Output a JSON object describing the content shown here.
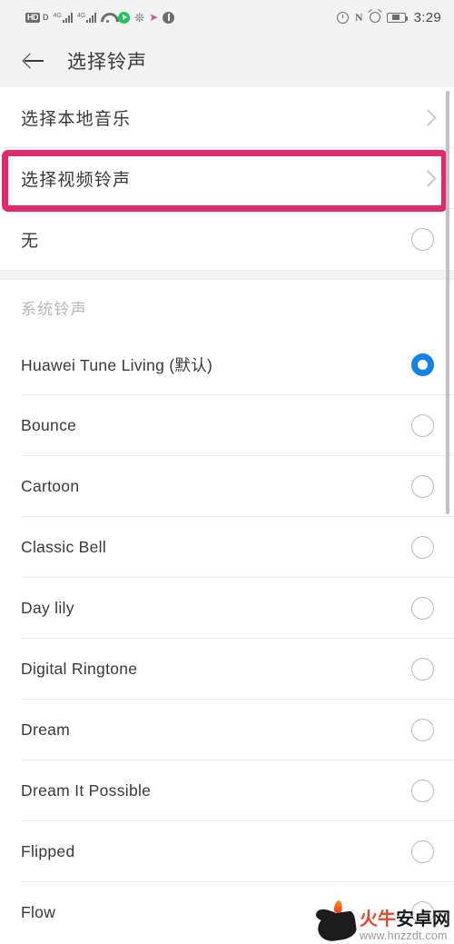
{
  "status_bar": {
    "icons_left": [
      "hd-icon",
      "volte-icon",
      "signal-4g-1-icon",
      "signal-4g-2-icon",
      "wifi-icon",
      "green-play-icon",
      "huawei-petal-icon",
      "purple-arrow-icon",
      "music-icon"
    ],
    "hd_label": "HD",
    "volte_label": "D",
    "network_label_1": "4G",
    "network_label_2": "4G",
    "nfc_label": "N",
    "icons_right": [
      "dnd-icon",
      "nfc-icon",
      "alarm-icon",
      "battery-icon"
    ],
    "time": "3:29"
  },
  "header": {
    "back_label": "back-arrow",
    "title": "选择铃声"
  },
  "top_actions": [
    {
      "label": "选择本地音乐",
      "accessory": "chevron-right-icon"
    },
    {
      "label": "选择视频铃声",
      "accessory": "chevron-right-icon",
      "highlighted": true
    }
  ],
  "none_row": {
    "label": "无",
    "selected": false
  },
  "section": {
    "title": "系统铃声"
  },
  "ringtones": [
    {
      "label": "Huawei Tune Living (默认)",
      "selected": true
    },
    {
      "label": "Bounce",
      "selected": false
    },
    {
      "label": "Cartoon",
      "selected": false
    },
    {
      "label": "Classic Bell",
      "selected": false
    },
    {
      "label": "Day lily",
      "selected": false
    },
    {
      "label": "Digital Ringtone",
      "selected": false
    },
    {
      "label": "Dream",
      "selected": false
    },
    {
      "label": "Dream It Possible",
      "selected": false
    },
    {
      "label": "Flipped",
      "selected": false
    },
    {
      "label": "Flow",
      "selected": false
    }
  ],
  "highlight": {
    "color": "#e02a6e",
    "target": "选择视频铃声"
  },
  "watermark": {
    "brand_red": "火牛",
    "brand_black": "安卓网",
    "url": "www.hnzzdt.com"
  },
  "colors": {
    "accent_blue": "#1283e6",
    "highlight_pink": "#e02a6e",
    "status_bar_bg": "#f2f2f2",
    "text_primary": "#36393d",
    "text_muted": "#b6b6b6"
  }
}
